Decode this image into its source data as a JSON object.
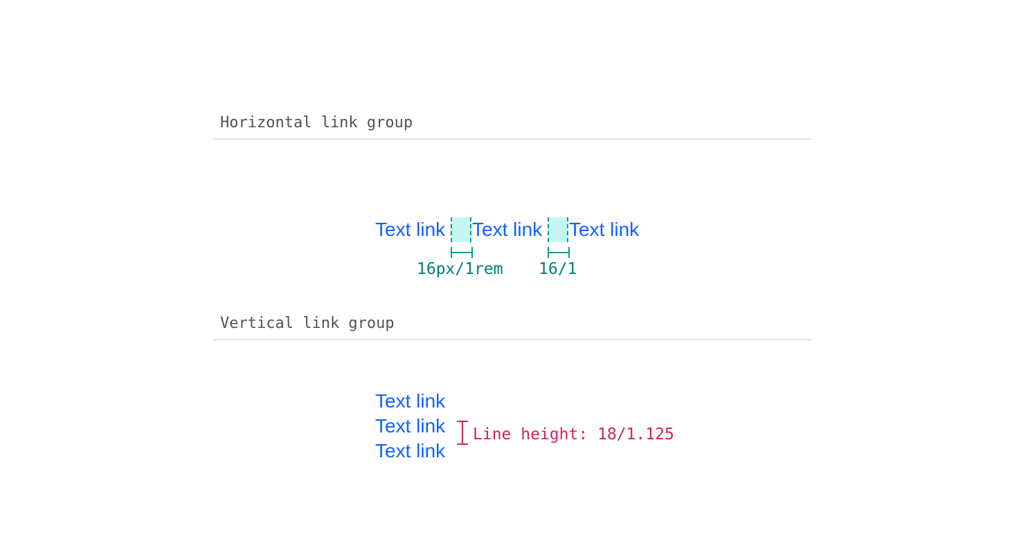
{
  "horizontal_section": {
    "title": "Horizontal link group",
    "links": [
      "Text link",
      "Text link",
      "Text link"
    ],
    "spacing_labels": [
      "16px/1rem",
      "16/1"
    ]
  },
  "vertical_section": {
    "title": "Vertical link group",
    "links": [
      "Text link",
      "Text link",
      "Text link"
    ],
    "line_height_label": "Line height: 18/1.125"
  },
  "colors": {
    "link": "#0f62fe",
    "spacing_annotation": "#009d9a",
    "line_height_annotation": "#d0225e",
    "section_title": "#525252",
    "divider": "#e0e0e0"
  }
}
